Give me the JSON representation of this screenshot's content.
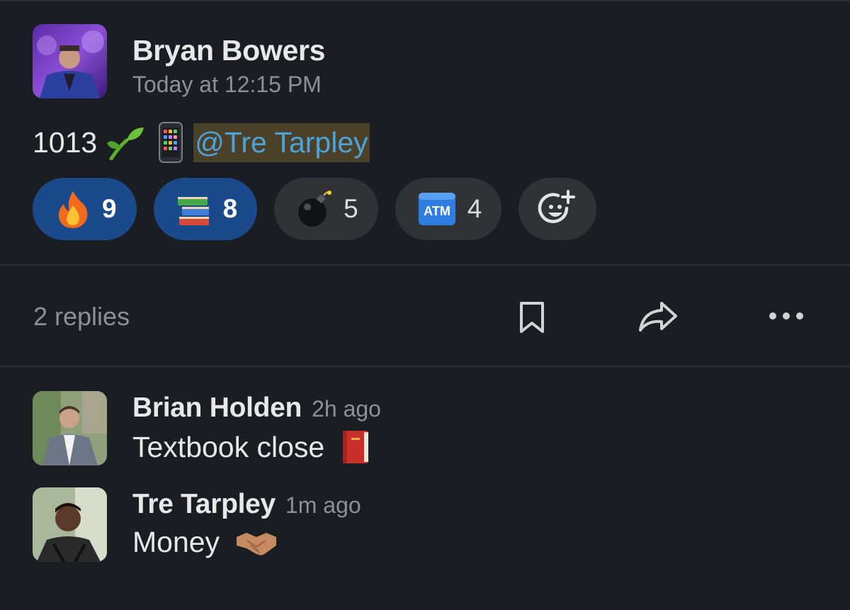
{
  "message": {
    "author": "Bryan Bowers",
    "timestamp": "Today at 12:15 PM",
    "number_text": "1013",
    "mention": "@Tre Tarpley",
    "emojis": [
      "seedling-icon",
      "mobile-phone-icon"
    ]
  },
  "reactions": [
    {
      "icon": "fire-icon",
      "count": "9",
      "active": true
    },
    {
      "icon": "books-icon",
      "count": "8",
      "active": true
    },
    {
      "icon": "bomb-icon",
      "count": "5",
      "active": false
    },
    {
      "icon": "atm-icon",
      "count": "4",
      "active": false,
      "icon_text": "ATM"
    }
  ],
  "add_reaction_icon": "add-reaction-icon",
  "actions": {
    "replies_label": "2 replies",
    "icons": [
      "bookmark-icon",
      "share-icon",
      "more-icon"
    ]
  },
  "replies": [
    {
      "author": "Brian Holden",
      "time": "2h ago",
      "text": "Textbook close",
      "emoji": "red-book-icon"
    },
    {
      "author": "Tre Tarpley",
      "time": "1m ago",
      "text": "Money",
      "emoji": "handshake-icon"
    }
  ],
  "colors": {
    "background": "#1a1d21",
    "reaction_active": "#1b4a8c",
    "reaction_inactive": "#303236",
    "mention_text": "#4da3d9",
    "mention_bg": "#4a4128",
    "muted_text": "#8e9094"
  }
}
